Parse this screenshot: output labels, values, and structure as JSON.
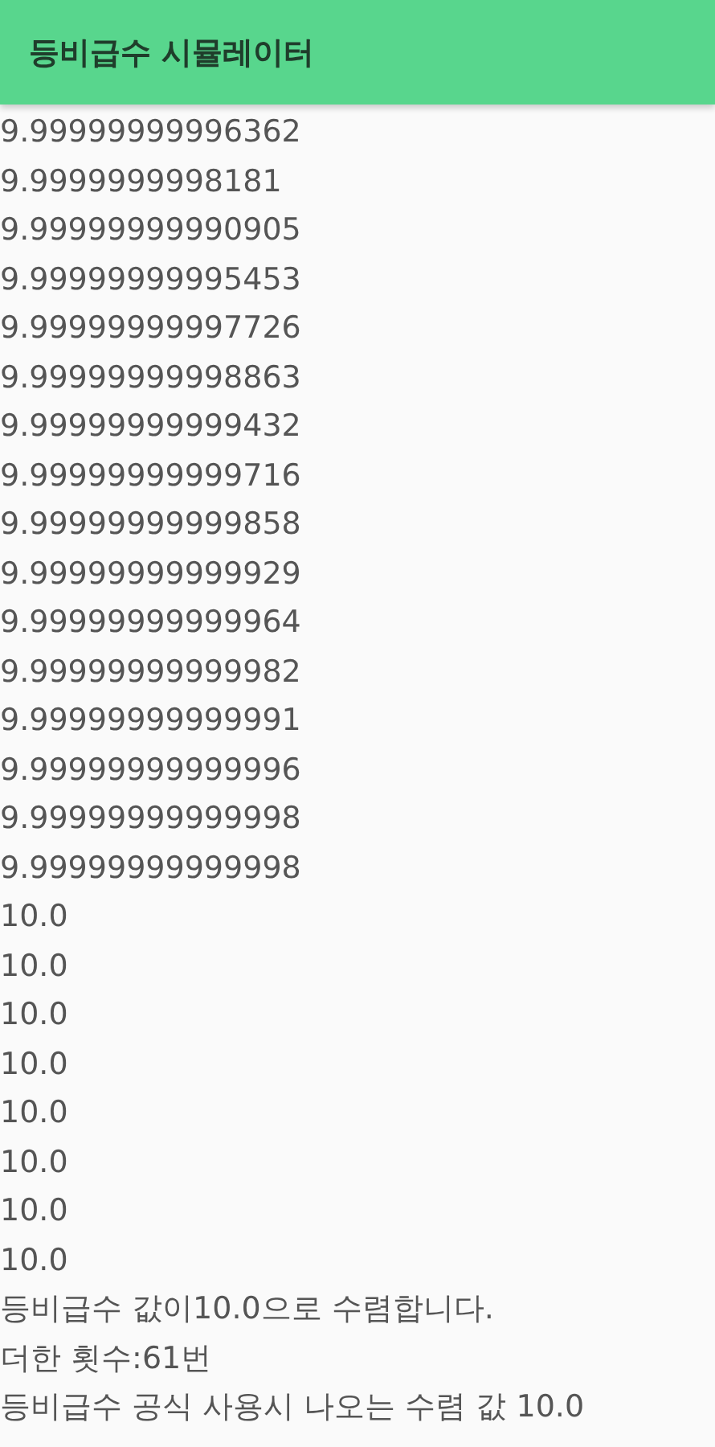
{
  "app_bar": {
    "title": "등비급수 시뮬레이터"
  },
  "output_lines": [
    "9.99999999996362",
    "9.9999999998181",
    "9.99999999990905",
    "9.99999999995453",
    "9.99999999997726",
    "9.99999999998863",
    "9.99999999999432",
    "9.99999999999716",
    "9.99999999999858",
    "9.99999999999929",
    "9.99999999999964",
    "9.99999999999982",
    "9.99999999999991",
    "9.99999999999996",
    "9.99999999999998",
    "9.99999999999998",
    "10.0",
    "10.0",
    "10.0",
    "10.0",
    "10.0",
    "10.0",
    "10.0",
    "10.0",
    "등비급수 값이10.0으로 수렴합니다.",
    "더한 횟수:61번",
    "등비급수 공식 사용시 나오는 수렴 값 10.0"
  ]
}
